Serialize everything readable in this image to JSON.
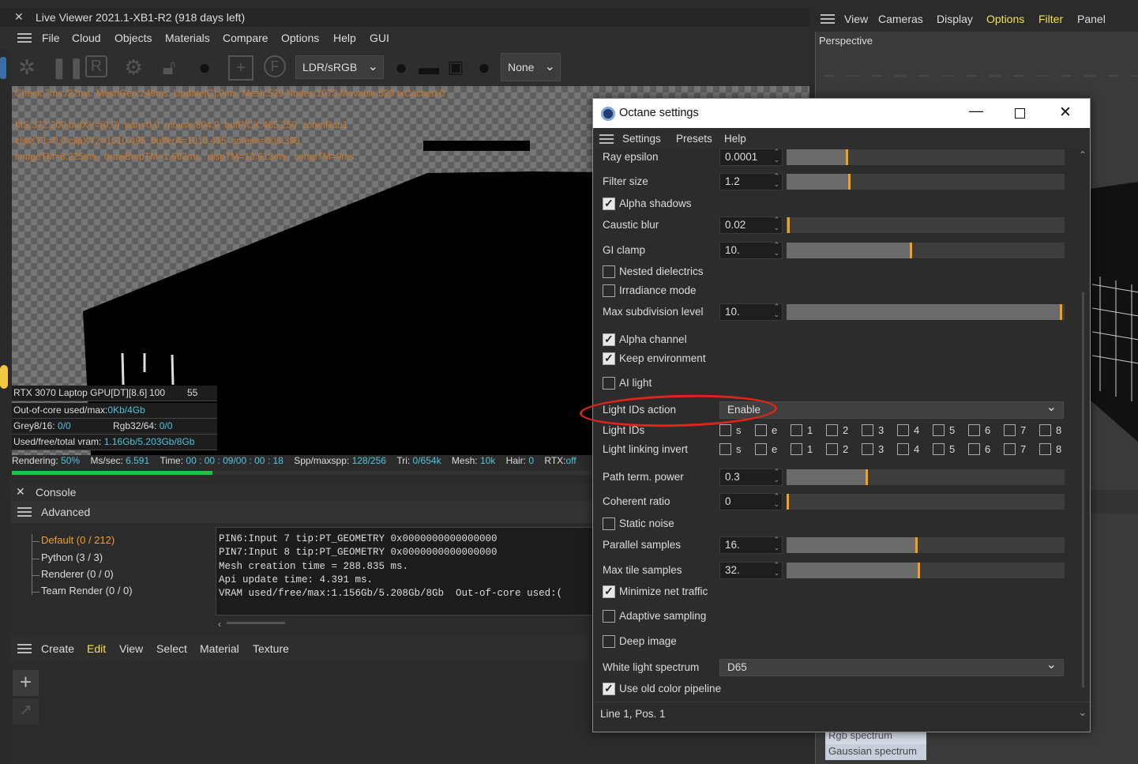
{
  "live_viewer": {
    "title": "Live Viewer 2021.1-XB1-R2 (918 days left)",
    "menu": [
      "File",
      "Cloud",
      "Objects",
      "Materials",
      "Compare",
      "Options",
      "Help",
      "GUI"
    ],
    "color_space": "LDR/sRGB",
    "selection": "None",
    "debug_lines": [
      "Check:7ms./22ms. MeshGen:249ms. Update[C]:0ms. Mesh:529 Nodes:1073 Movable:529 txCached:0",
      "MS:372,200 bufXY=(0,0)  pan=0,0  mouse:804,9  bufPICK:465,250  zoomRat:1",
      "clipXY1=0.0 clipXY2=1010.495  bufferA=1010.495  screen=808.396",
      "imageTM=8.225ms.  drawBmpTM=1.663ms.  dispTM=13.613ms.  compTM=0ms."
    ],
    "gpu": {
      "name": "RTX 3070 Laptop GPU[DT][8.6]",
      "value1": "100",
      "value2": "55"
    },
    "out_of_core": {
      "label": "Out-of-core used/max:",
      "value": "0Kb/4Gb"
    },
    "grey": {
      "label": "Grey8/16:",
      "value": "0/0"
    },
    "rgb": {
      "label": "Rgb32/64:",
      "value": "0/0"
    },
    "vram": {
      "label": "Used/free/total vram:",
      "value": "1.16Gb/5.203Gb/8Gb"
    },
    "render_status": {
      "rendering_label": "Rendering:",
      "rendering": "50%",
      "ms_label": "Ms/sec:",
      "ms": "6.591",
      "time_label": "Time:",
      "time": "00 : 00 : 09/00 : 00 : 18",
      "spp_label": "Spp/maxspp:",
      "spp": "128/256",
      "tri_label": "Tri:",
      "tri": "0/654k",
      "mesh_label": "Mesh:",
      "mesh": "10k",
      "hair_label": "Hair:",
      "hair": "0",
      "rtx_label": "RTX:",
      "rtx": "off"
    },
    "progress": 0.5
  },
  "console": {
    "title": "Console",
    "section": "Advanced",
    "tree": [
      "Default (0 / 212)",
      "Python (3 / 3)",
      "Renderer (0 / 0)",
      "Team Render  (0 / 0)"
    ],
    "log": [
      "PIN6:Input 7 tip:PT_GEOMETRY 0x0000000000000000",
      "PIN7:Input 8 tip:PT_GEOMETRY 0x0000000000000000",
      "Mesh creation time = 288.835 ms.",
      "Api update time: 4.391 ms.",
      "VRAM used/free/max:1.156Gb/5.208Gb/8Gb  Out-of-core used:("
    ]
  },
  "bottom_menu": [
    "Create",
    "Edit",
    "View",
    "Select",
    "Material",
    "Texture"
  ],
  "right_panel": {
    "menu": [
      "View",
      "Cameras",
      "Display",
      "Options",
      "Filter",
      "Panel"
    ],
    "viewport_label": "Perspective",
    "list": [
      "Rgb spectrum",
      "Gaussian spectrum"
    ]
  },
  "octane": {
    "title": "Octane settings",
    "menu": [
      "Settings",
      "Presets",
      "Help"
    ],
    "fields": {
      "ray_epsilon": {
        "label": "Ray epsilon",
        "value": "0.0001",
        "level": 0.23
      },
      "filter_size": {
        "label": "Filter size",
        "value": "1.2",
        "level": 0.24
      },
      "alpha_shadows": {
        "label": "Alpha shadows",
        "checked": true
      },
      "caustic_blur": {
        "label": "Caustic blur",
        "value": "0.02",
        "level": 0.02
      },
      "gi_clamp": {
        "label": "GI clamp",
        "value": "10.",
        "level": 0.46
      },
      "nested_dielectrics": {
        "label": "Nested dielectrics",
        "checked": false
      },
      "irradiance_mode": {
        "label": "Irradiance mode",
        "checked": false
      },
      "max_subdivision": {
        "label": "Max subdivision level",
        "value": "10.",
        "level": 1.0
      },
      "alpha_channel": {
        "label": "Alpha channel",
        "checked": true
      },
      "keep_environment": {
        "label": "Keep environment",
        "checked": true
      },
      "ai_light": {
        "label": "AI light",
        "checked": false
      },
      "light_ids_action": {
        "label": "Light IDs action",
        "value": "Enable"
      },
      "light_ids": {
        "label": "Light IDs"
      },
      "light_linking_invert": {
        "label": "Light linking invert"
      },
      "path_term_power": {
        "label": "Path term. power",
        "value": "0.3",
        "level": 0.3
      },
      "coherent_ratio": {
        "label": "Coherent ratio",
        "value": "0",
        "level": 0.0
      },
      "static_noise": {
        "label": "Static noise",
        "checked": false
      },
      "parallel_samples": {
        "label": "Parallel samples",
        "value": "16.",
        "level": 0.48
      },
      "max_tile_samples": {
        "label": "Max tile samples",
        "value": "32.",
        "level": 0.49
      },
      "minimize_net_traffic": {
        "label": "Minimize net traffic",
        "checked": true
      },
      "adaptive_sampling": {
        "label": "Adaptive sampling",
        "checked": false
      },
      "deep_image": {
        "label": "Deep image",
        "checked": false
      },
      "white_light_spectrum": {
        "label": "White light spectrum",
        "value": "D65"
      },
      "use_old_color_pipeline": {
        "label": "Use old color pipeline",
        "checked": true
      }
    },
    "light_id_options": [
      "s",
      "e",
      "1",
      "2",
      "3",
      "4",
      "5",
      "6",
      "7",
      "8"
    ],
    "status": "Line 1, Pos. 1"
  }
}
